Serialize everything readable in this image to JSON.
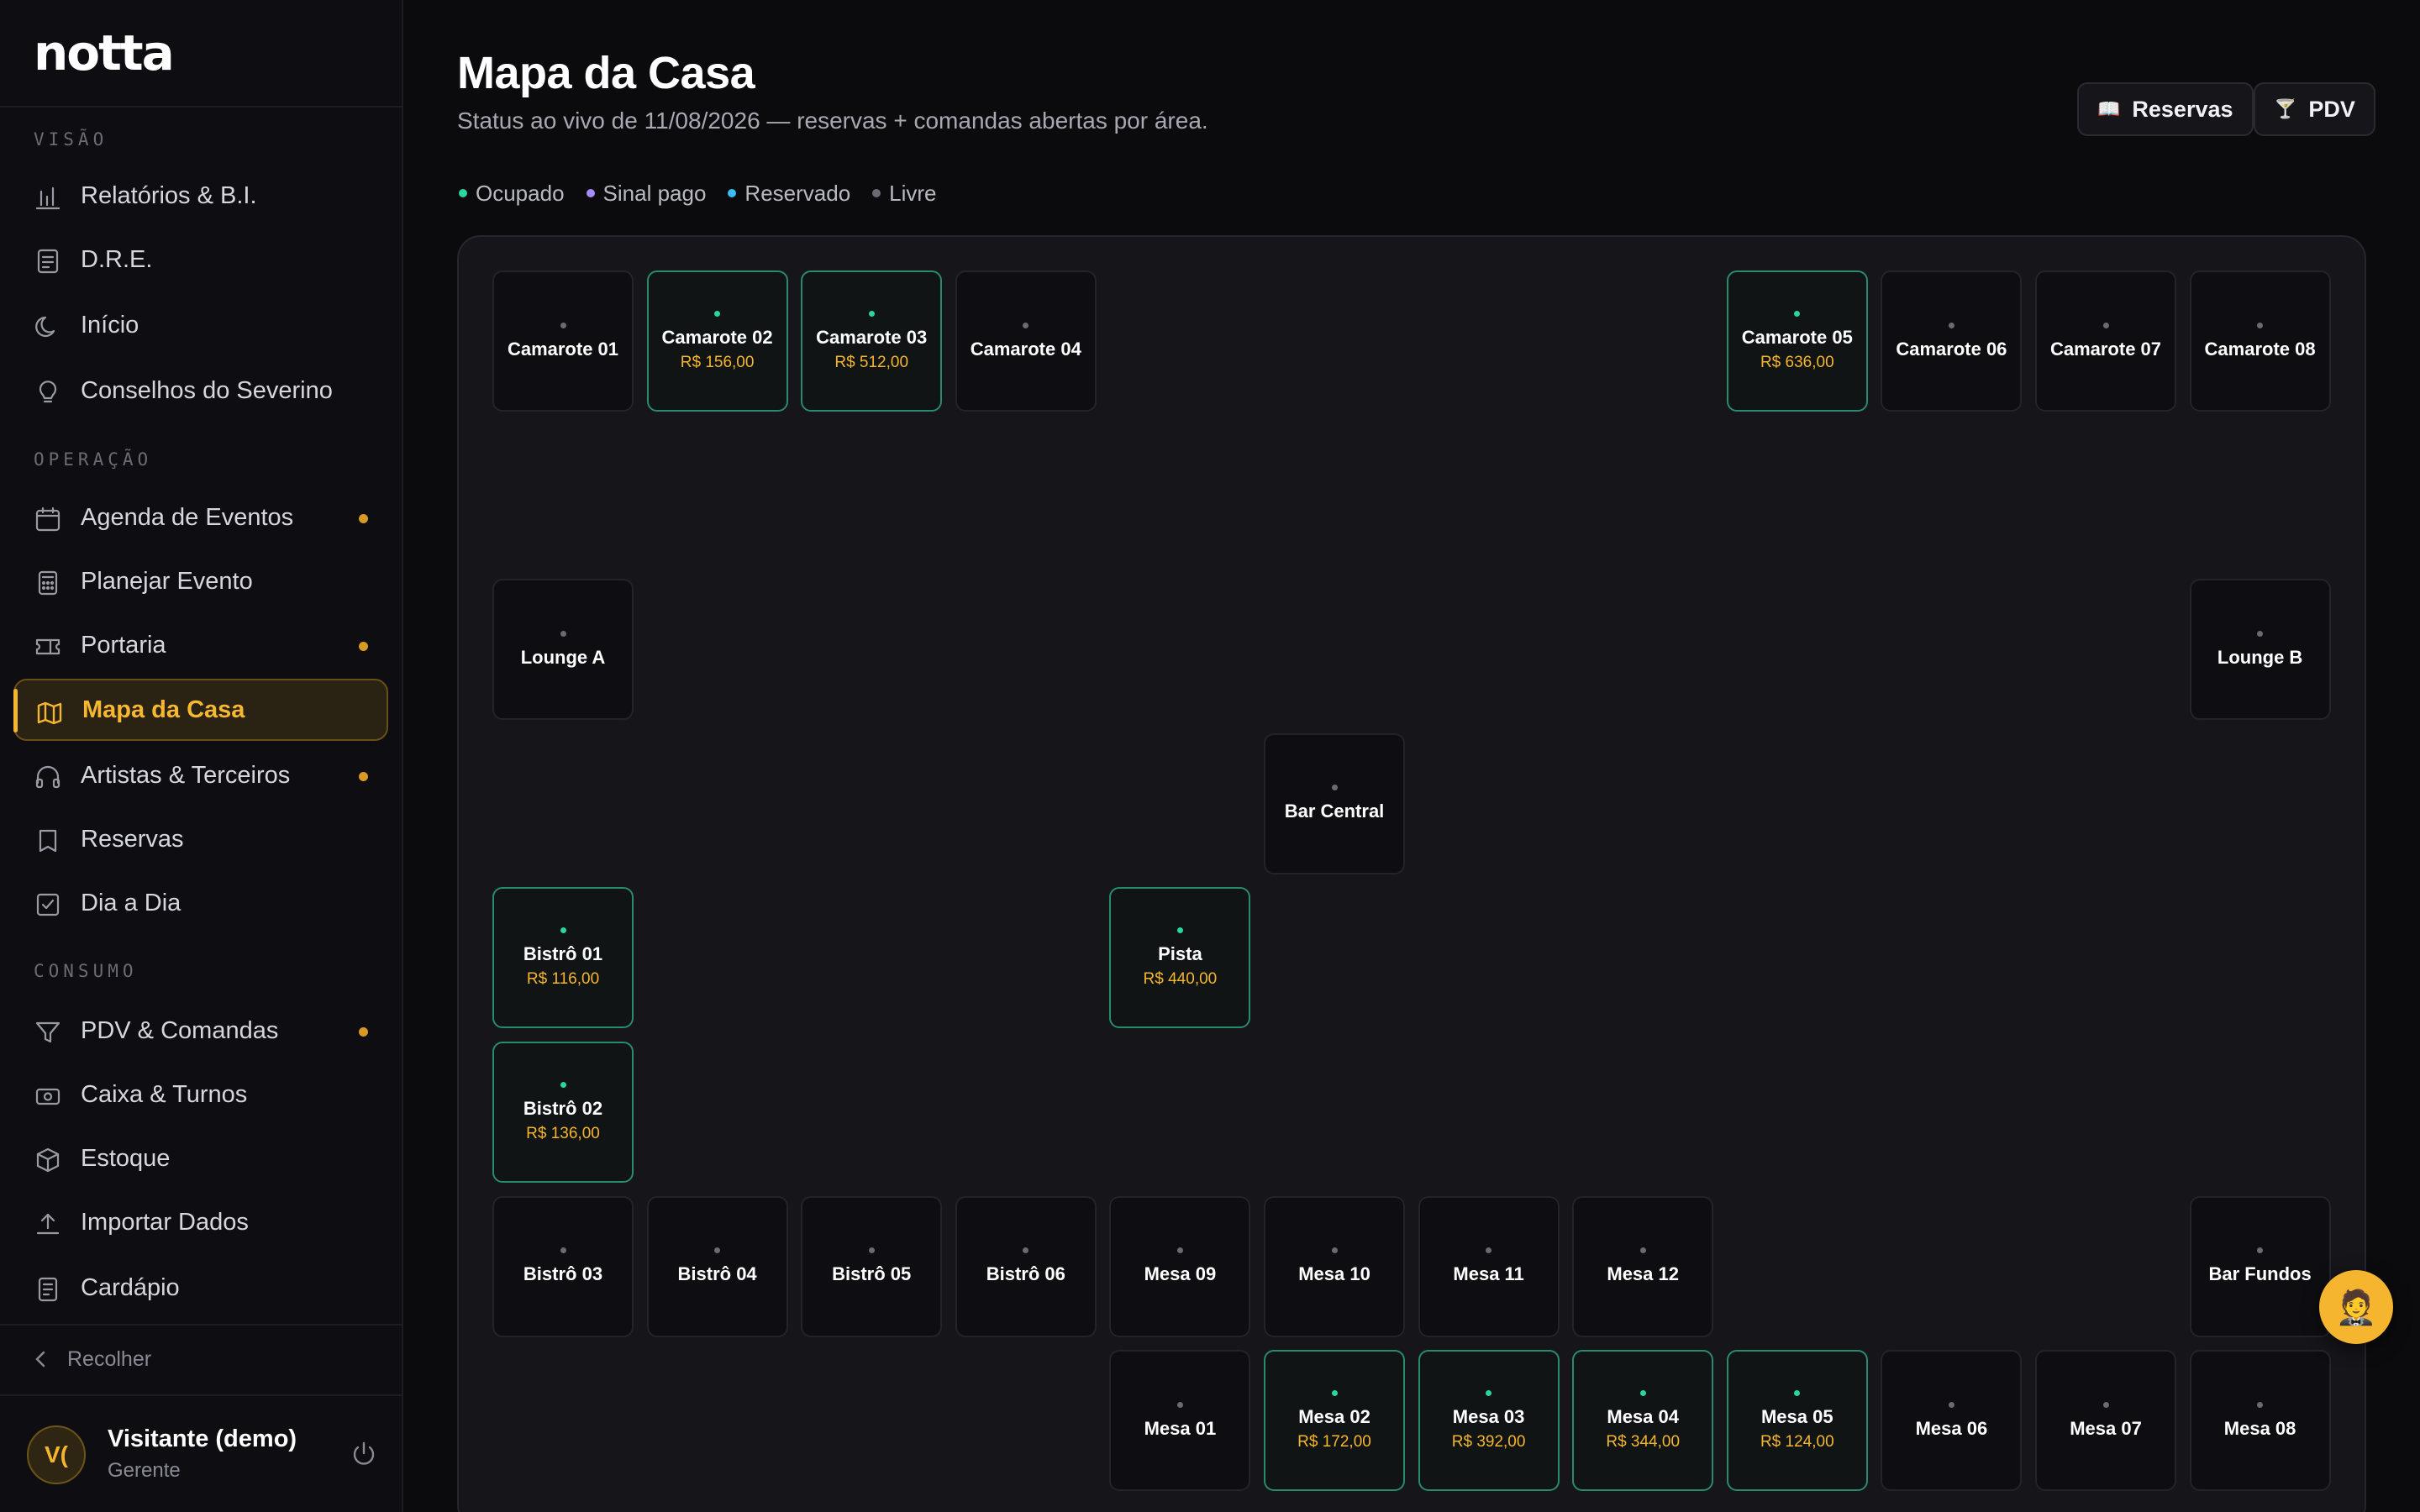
{
  "app": {
    "logo": "notta"
  },
  "sidebar": {
    "sections": [
      {
        "label": "VISÃO",
        "items": [
          {
            "label": "Relatórios & B.I.",
            "icon": "bar-chart-icon",
            "dot": false,
            "active": false
          },
          {
            "label": "D.R.E.",
            "icon": "document-icon",
            "dot": false,
            "active": false
          },
          {
            "label": "Início",
            "icon": "moon-icon",
            "dot": false,
            "active": false
          },
          {
            "label": "Conselhos do Severino",
            "icon": "lightbulb-icon",
            "dot": false,
            "active": false
          }
        ]
      },
      {
        "label": "OPERAÇÃO",
        "items": [
          {
            "label": "Agenda de Eventos",
            "icon": "calendar-icon",
            "dot": true,
            "active": false
          },
          {
            "label": "Planejar Evento",
            "icon": "calculator-icon",
            "dot": false,
            "active": false
          },
          {
            "label": "Portaria",
            "icon": "ticket-icon",
            "dot": true,
            "active": false
          },
          {
            "label": "Mapa da Casa",
            "icon": "map-icon",
            "dot": false,
            "active": true
          },
          {
            "label": "Artistas & Terceiros",
            "icon": "headphones-icon",
            "dot": true,
            "active": false
          },
          {
            "label": "Reservas",
            "icon": "bookmark-icon",
            "dot": false,
            "active": false
          },
          {
            "label": "Dia a Dia",
            "icon": "check-square-icon",
            "dot": false,
            "active": false
          }
        ]
      },
      {
        "label": "CONSUMO",
        "items": [
          {
            "label": "PDV & Comandas",
            "icon": "funnel-icon",
            "dot": true,
            "active": false
          },
          {
            "label": "Caixa & Turnos",
            "icon": "cash-icon",
            "dot": false,
            "active": false
          },
          {
            "label": "Estoque",
            "icon": "box-icon",
            "dot": false,
            "active": false
          },
          {
            "label": "Importar Dados",
            "icon": "upload-icon",
            "dot": false,
            "active": false
          },
          {
            "label": "Cardápio",
            "icon": "menu-book-icon",
            "dot": false,
            "active": false
          }
        ]
      }
    ],
    "collapse_label": "Recolher",
    "user": {
      "initials": "V(",
      "name": "Visitante (demo)",
      "role": "Gerente"
    }
  },
  "header": {
    "title": "Mapa da Casa",
    "subtitle": "Status ao vivo de 11/08/2026 — reservas + comandas abertas por área.",
    "buttons": [
      {
        "label": "Reservas",
        "icon": "📖"
      },
      {
        "label": "PDV",
        "icon": "🍸"
      }
    ]
  },
  "legend": [
    {
      "label": "Ocupado",
      "color": "#2bd69a"
    },
    {
      "label": "Sinal pago",
      "color": "#a78bfa"
    },
    {
      "label": "Reservado",
      "color": "#38bdf8"
    },
    {
      "label": "Livre",
      "color": "#6a6a72"
    }
  ],
  "tiles": [
    {
      "name": "Camarote 01",
      "status": "livre",
      "amount": ""
    },
    {
      "name": "Camarote 02",
      "status": "ocupado",
      "amount": "R$ 156,00"
    },
    {
      "name": "Camarote 03",
      "status": "ocupado",
      "amount": "R$ 512,00"
    },
    {
      "name": "Camarote 04",
      "status": "livre",
      "amount": ""
    },
    {
      "name": "Camarote 05",
      "status": "ocupado",
      "amount": "R$ 636,00"
    },
    {
      "name": "Camarote 06",
      "status": "livre",
      "amount": ""
    },
    {
      "name": "Camarote 07",
      "status": "livre",
      "amount": ""
    },
    {
      "name": "Camarote 08",
      "status": "livre",
      "amount": ""
    },
    {
      "name": "Lounge A",
      "status": "livre",
      "amount": ""
    },
    {
      "name": "Lounge B",
      "status": "livre",
      "amount": ""
    },
    {
      "name": "Bar Central",
      "status": "livre",
      "amount": ""
    },
    {
      "name": "Bistrô 01",
      "status": "ocupado",
      "amount": "R$ 116,00"
    },
    {
      "name": "Pista",
      "status": "ocupado",
      "amount": "R$ 440,00"
    },
    {
      "name": "Bistrô 02",
      "status": "ocupado",
      "amount": "R$ 136,00"
    },
    {
      "name": "Bistrô 03",
      "status": "livre",
      "amount": ""
    },
    {
      "name": "Bistrô 04",
      "status": "livre",
      "amount": ""
    },
    {
      "name": "Bistrô 05",
      "status": "livre",
      "amount": ""
    },
    {
      "name": "Bistrô 06",
      "status": "livre",
      "amount": ""
    },
    {
      "name": "Mesa 09",
      "status": "livre",
      "amount": ""
    },
    {
      "name": "Mesa 10",
      "status": "livre",
      "amount": ""
    },
    {
      "name": "Mesa 11",
      "status": "livre",
      "amount": ""
    },
    {
      "name": "Mesa 12",
      "status": "livre",
      "amount": ""
    },
    {
      "name": "Bar Fundos",
      "status": "livre",
      "amount": ""
    },
    {
      "name": "Mesa 01",
      "status": "livre",
      "amount": ""
    },
    {
      "name": "Mesa 02",
      "status": "ocupado",
      "amount": "R$ 172,00"
    },
    {
      "name": "Mesa 03",
      "status": "ocupado",
      "amount": "R$ 392,00"
    },
    {
      "name": "Mesa 04",
      "status": "ocupado",
      "amount": "R$ 344,00"
    },
    {
      "name": "Mesa 05",
      "status": "ocupado",
      "amount": "R$ 124,00"
    },
    {
      "name": "Mesa 06",
      "status": "livre",
      "amount": ""
    },
    {
      "name": "Mesa 07",
      "status": "livre",
      "amount": ""
    },
    {
      "name": "Mesa 08",
      "status": "livre",
      "amount": ""
    }
  ],
  "assistant": {
    "icon": "🤵"
  }
}
